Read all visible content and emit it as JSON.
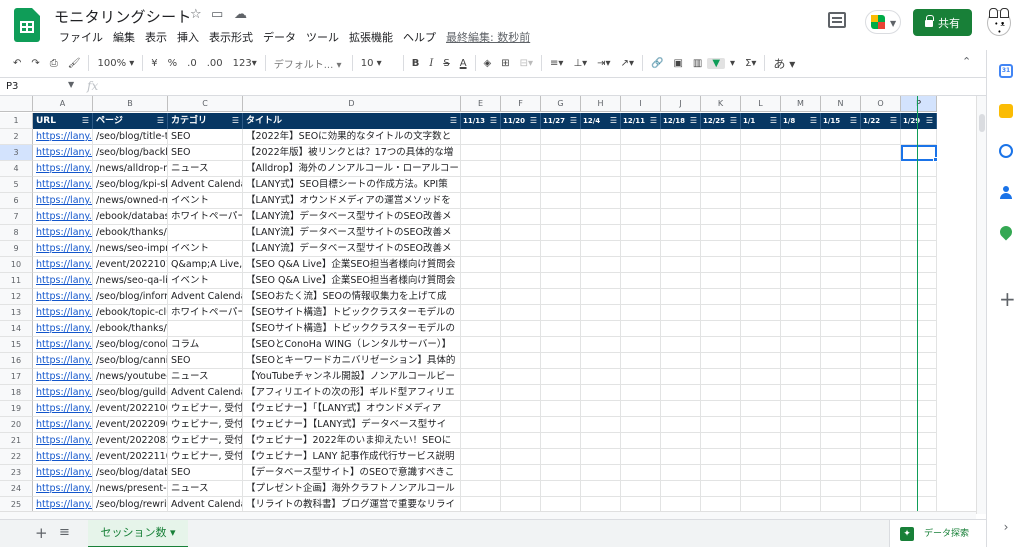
{
  "doc": {
    "title": "モニタリングシート",
    "last_edit": "最終編集: 数秒前"
  },
  "menu": [
    "ファイル",
    "編集",
    "表示",
    "挿入",
    "表示形式",
    "データ",
    "ツール",
    "拡張機能",
    "ヘルプ"
  ],
  "share": {
    "label": "共有"
  },
  "toolbar": {
    "zoom": "100%",
    "currency": "¥",
    "percent": "%",
    "dec_decrease": ".0",
    "dec_increase": ".00",
    "number_format": "123",
    "font": "デフォルト...",
    "font_size": "10",
    "bold": "B",
    "italic": "I",
    "strike": "S",
    "text_color": "A",
    "input_tool": "あ"
  },
  "formula": {
    "cell_ref": "P3",
    "fx": "fx"
  },
  "columns": [
    "A",
    "B",
    "C",
    "D",
    "E",
    "F",
    "G",
    "H",
    "I",
    "J",
    "K",
    "L",
    "M",
    "N",
    "O",
    "P"
  ],
  "header": {
    "url": "URL",
    "page": "ページ",
    "category": "カテゴリ",
    "title": "タイトル",
    "dates": [
      "11/13",
      "11/20",
      "11/27",
      "12/4",
      "12/11",
      "12/18",
      "12/25",
      "1/1",
      "1/8",
      "1/15",
      "1/22",
      "1/29"
    ]
  },
  "rows": [
    {
      "n": "1"
    },
    {
      "n": "2",
      "url": "https://lany.c",
      "page": "/seo/blog/title-ta",
      "cat": "SEO",
      "title": "【2022年】SEOに効果的なタイトルの文字数と"
    },
    {
      "n": "3",
      "url": "https://lany.c",
      "page": "/seo/blog/backlin",
      "cat": "SEO",
      "title": "【2022年版】被リンクとは？17つの具体的な増"
    },
    {
      "n": "4",
      "url": "https://lany.c",
      "page": "/news/alldrop-no",
      "cat": "ニュース",
      "title": "【Alldrop】海外のノンアルコール・ローアルコー"
    },
    {
      "n": "5",
      "url": "https://lany.c",
      "page": "/seo/blog/kpi-she",
      "cat": "Advent Calendar",
      "title": "【LANY式】SEO目標シートの作成方法。KPI策"
    },
    {
      "n": "6",
      "url": "https://lany.c",
      "page": "/news/owned-me",
      "cat": "イベント",
      "title": "【LANY式】オウンドメディアの運営メソッドを"
    },
    {
      "n": "7",
      "url": "https://lany.c",
      "page": "/ebook/database",
      "cat": "ホワイトペーパー",
      "title": "【LANY流】データベース型サイトのSEO改善メ"
    },
    {
      "n": "8",
      "url": "https://lany.c",
      "page": "/ebook/thanks/da",
      "cat": "",
      "title": "【LANY流】データベース型サイトのSEO改善メ"
    },
    {
      "n": "9",
      "url": "https://lany.c",
      "page": "/news/seo-impro",
      "cat": "イベント",
      "title": "【LANY流】データベース型サイトのSEO改善メ"
    },
    {
      "n": "10",
      "url": "https://lany.c",
      "page": "/event/20221019",
      "cat": "Q&amp;A Live, ウ",
      "title": "【SEO Q&A Live】企業SEO担当者様向け質問会"
    },
    {
      "n": "11",
      "url": "https://lany.c",
      "page": "/news/seo-qa-liv",
      "cat": "イベント",
      "title": "【SEO Q&A Live】企業SEO担当者様向け質問会"
    },
    {
      "n": "12",
      "url": "https://lany.c",
      "page": "/seo/blog/informa",
      "cat": "Advent Calendar",
      "title": "【SEOおたく流】SEOの情報収集力を上げて成"
    },
    {
      "n": "13",
      "url": "https://lany.c",
      "page": "/ebook/topic-clus",
      "cat": "ホワイトペーパー",
      "title": "【SEOサイト構造】トピッククラスターモデルの"
    },
    {
      "n": "14",
      "url": "https://lany.c",
      "page": "/ebook/thanks/to",
      "cat": "",
      "title": "【SEOサイト構造】トピッククラスターモデルの"
    },
    {
      "n": "15",
      "url": "https://lany.c",
      "page": "/seo/blog/conoha",
      "cat": "コラム",
      "title": "【SEOとConoHa WING（レンタルサーバー）】"
    },
    {
      "n": "16",
      "url": "https://lany.c",
      "page": "/seo/blog/cannib",
      "cat": "SEO",
      "title": "【SEOとキーワードカニバリゼーション】具体的"
    },
    {
      "n": "17",
      "url": "https://lany.c",
      "page": "/news/youtube-c",
      "cat": "ニュース",
      "title": "【YouTubeチャンネル開設】ノンアルコールビー"
    },
    {
      "n": "18",
      "url": "https://lany.c",
      "page": "/seo/blog/guild-a",
      "cat": "Advent Calendar",
      "title": "【アフィリエイトの次の形】ギルド型アフィリエ"
    },
    {
      "n": "19",
      "url": "https://lany.c",
      "page": "/event/20221005",
      "cat": "ウェビナー, 受付",
      "title": "【ウェビナー】「【LANY式】オウンドメディア"
    },
    {
      "n": "20",
      "url": "https://lany.c",
      "page": "/event/20220907",
      "cat": "ウェビナー, 受付",
      "title": "【ウェビナー】【LANY式】データベース型サイ"
    },
    {
      "n": "21",
      "url": "https://lany.c",
      "page": "/event/20220824",
      "cat": "ウェビナー, 受付",
      "title": "【ウェビナー】2022年のいま抑えたい！SEOに"
    },
    {
      "n": "22",
      "url": "https://lany.c",
      "page": "/event/20221109",
      "cat": "ウェビナー, 受付",
      "title": "【ウェビナー】LANY 記事作成代行サービス説明"
    },
    {
      "n": "23",
      "url": "https://lany.c",
      "page": "/seo/blog/databa",
      "cat": "SEO",
      "title": "【データベース型サイト】のSEOで意識すべきこ"
    },
    {
      "n": "24",
      "url": "https://lany.c",
      "page": "/news/present-ca",
      "cat": "ニュース",
      "title": "【プレゼント企画】海外クラフトノンアルコール"
    },
    {
      "n": "25",
      "url": "https://lany.c",
      "page": "/seo/blog/rewrite",
      "cat": "Advent Calendar",
      "title": "【リライトの教科書】ブログ運営で重要なリライ"
    }
  ],
  "sheet": {
    "tab_label": "セッション数",
    "explore_label": "データ探索"
  },
  "side": {
    "calendar_day": "31"
  },
  "colors": {
    "brand": "#0f9d58",
    "header_bg": "#073763",
    "share": "#188038",
    "link": "#1155cc",
    "selection": "#1a73e8"
  }
}
